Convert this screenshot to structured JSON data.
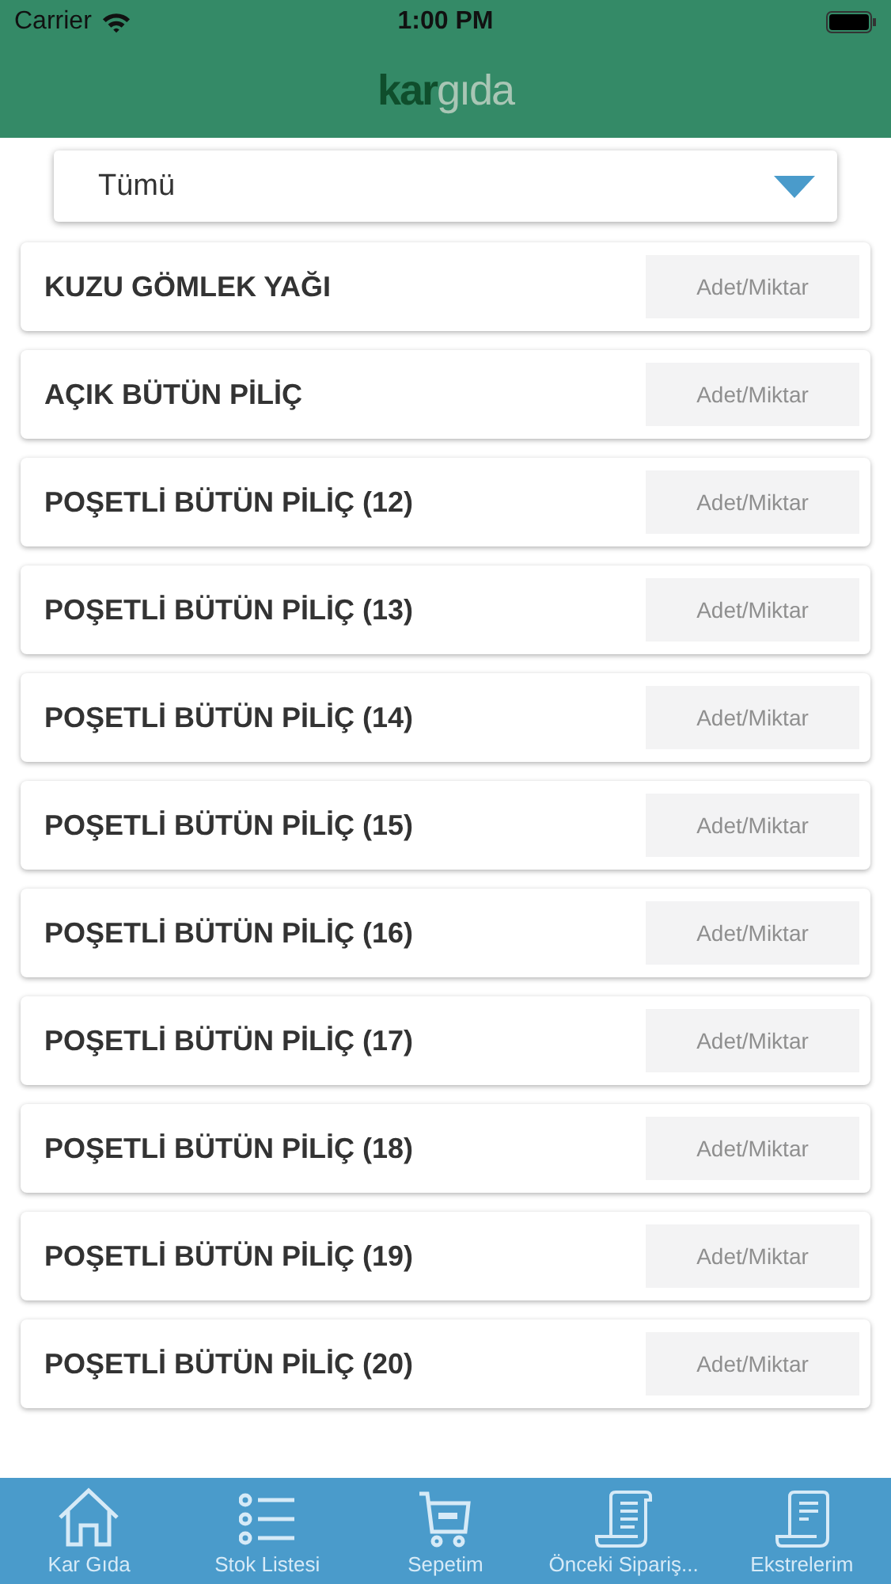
{
  "status_bar": {
    "carrier": "Carrier",
    "time": "1:00 PM"
  },
  "header": {
    "logo_left": "kar",
    "logo_right": "gıda"
  },
  "filter": {
    "value": "Tümü"
  },
  "products": [
    {
      "name": "KUZU GÖMLEK YAĞI",
      "placeholder": "Adet/Miktar"
    },
    {
      "name": "AÇIK BÜTÜN PİLİÇ",
      "placeholder": "Adet/Miktar"
    },
    {
      "name": "POŞETLİ BÜTÜN PİLİÇ (12)",
      "placeholder": "Adet/Miktar"
    },
    {
      "name": "POŞETLİ BÜTÜN PİLİÇ (13)",
      "placeholder": "Adet/Miktar"
    },
    {
      "name": "POŞETLİ BÜTÜN PİLİÇ (14)",
      "placeholder": "Adet/Miktar"
    },
    {
      "name": "POŞETLİ BÜTÜN PİLİÇ (15)",
      "placeholder": "Adet/Miktar"
    },
    {
      "name": "POŞETLİ BÜTÜN PİLİÇ (16)",
      "placeholder": "Adet/Miktar"
    },
    {
      "name": "POŞETLİ BÜTÜN PİLİÇ (17)",
      "placeholder": "Adet/Miktar"
    },
    {
      "name": "POŞETLİ BÜTÜN PİLİÇ (18)",
      "placeholder": "Adet/Miktar"
    },
    {
      "name": "POŞETLİ BÜTÜN PİLİÇ (19)",
      "placeholder": "Adet/Miktar"
    },
    {
      "name": "POŞETLİ BÜTÜN PİLİÇ (20)",
      "placeholder": "Adet/Miktar"
    }
  ],
  "tabs": [
    {
      "kind": "home",
      "label": "Kar Gıda"
    },
    {
      "kind": "list",
      "label": "Stok Listesi"
    },
    {
      "kind": "cart",
      "label": "Sepetim"
    },
    {
      "kind": "scroll",
      "label": "Önceki Sipariş..."
    },
    {
      "kind": "receipt",
      "label": "Ekstrelerim"
    }
  ]
}
